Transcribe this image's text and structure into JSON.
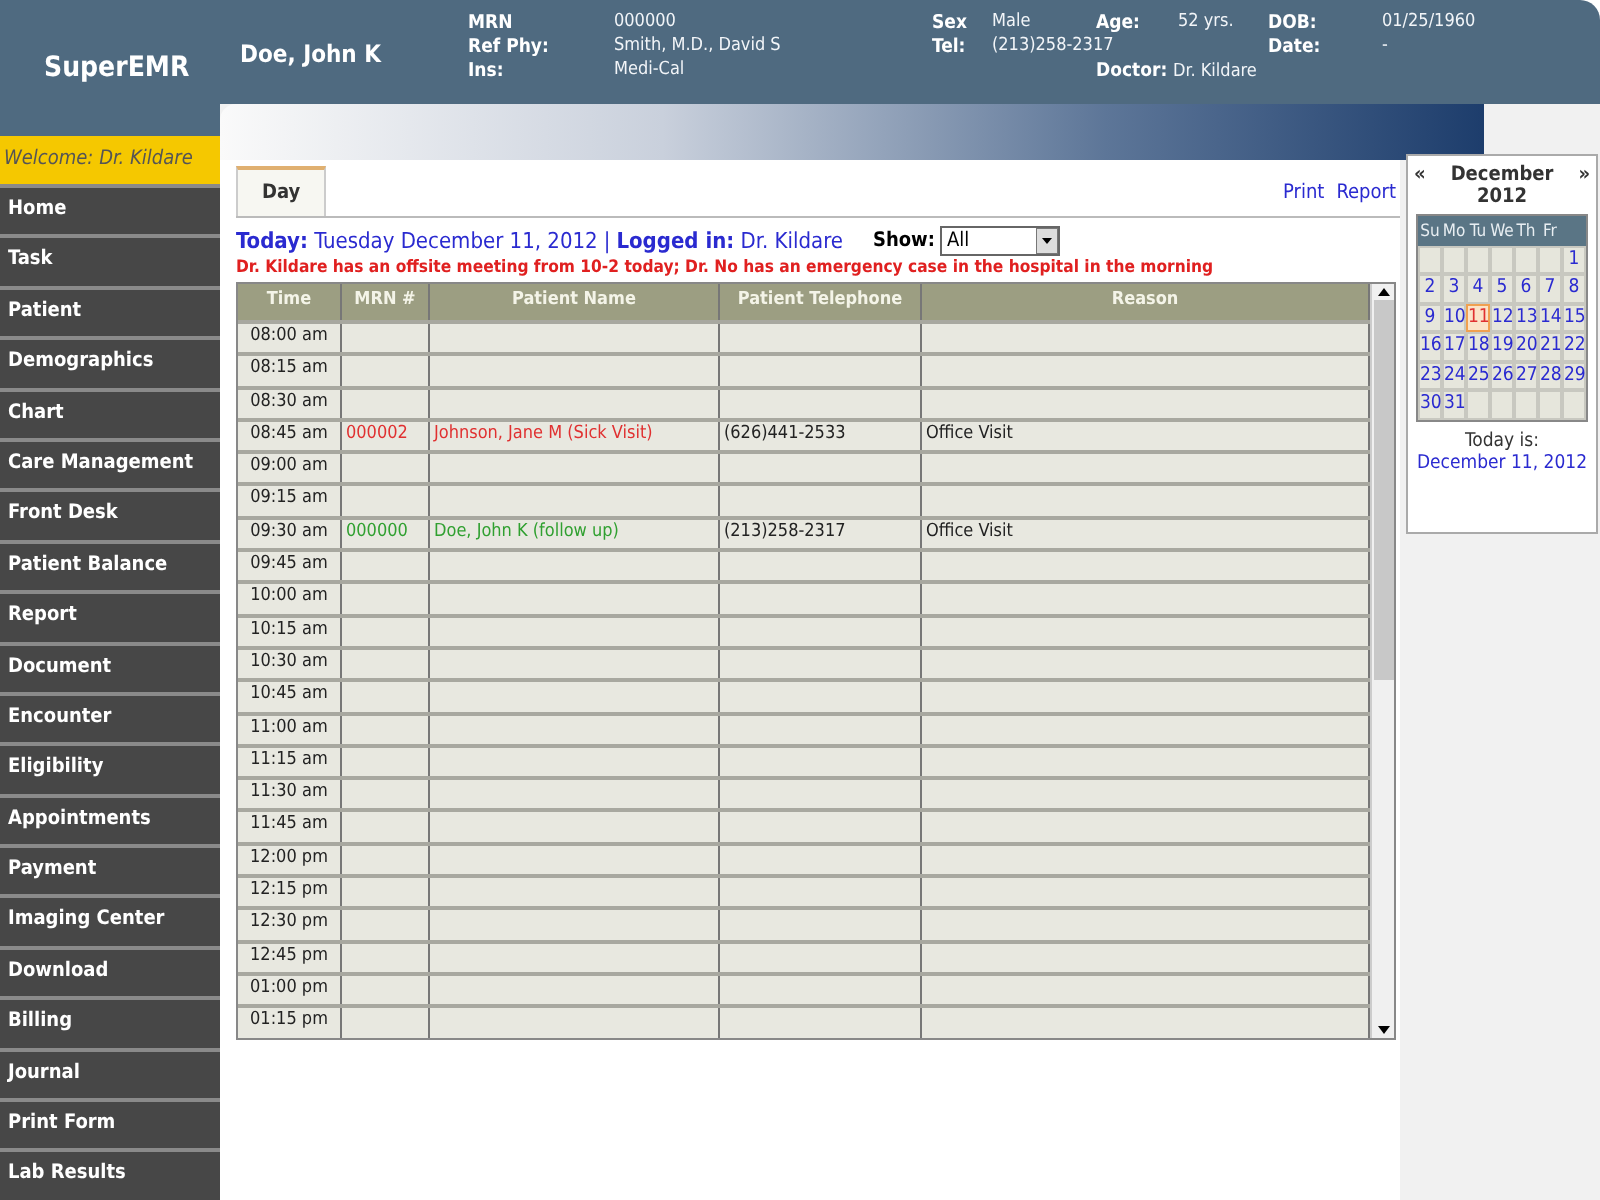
{
  "header": {
    "logo": "SuperEMR",
    "patient_name": "Doe, John K",
    "group_1": [
      {
        "label": "MRN",
        "value": "000000"
      },
      {
        "label": "Ref Phy:",
        "value": "Smith, M.D., David S"
      },
      {
        "label": "Ins:",
        "value": "Medi-Cal"
      }
    ],
    "group_2": [
      {
        "label": "Sex",
        "value": "Male"
      },
      {
        "label": "Tel:",
        "value": "(213)258-2317"
      }
    ],
    "group_3": [
      {
        "label": "Age:",
        "value": "52 yrs."
      }
    ],
    "doctor": {
      "label": "Doctor:",
      "value": "Dr. Kildare"
    },
    "group_4": [
      {
        "label": "DOB:",
        "value": "01/25/1960"
      },
      {
        "label": "Date:",
        "value": "-"
      }
    ]
  },
  "sidebar": {
    "welcome": "Welcome: Dr. Kildare",
    "items": [
      "Home",
      "Task",
      "Patient",
      "Demographics",
      "Chart",
      "Care Management",
      "Front Desk",
      "Patient Balance",
      "Report",
      "Document",
      "Encounter",
      "Eligibility",
      "Appointments",
      "Payment",
      "Imaging Center",
      "Download",
      "Billing",
      "Journal",
      "Print Form",
      "Lab Results"
    ]
  },
  "tabs": [
    {
      "label": "Day",
      "selected": true
    }
  ],
  "links": [
    "Print",
    "Report"
  ],
  "today_label": "Today:",
  "today_value": "Tuesday December 11, 2012",
  "separator": "|",
  "logged_label": "Logged in:",
  "logged_value": "Dr. Kildare",
  "show": {
    "label": "Show:",
    "value": "All"
  },
  "notice": "Dr. Kildare has an offsite meeting from 10-2 today; Dr. No has an emergency case in the hospital in the morning",
  "table": {
    "columns": [
      "Time",
      "MRN #",
      "Patient Name",
      "Patient Telephone",
      "Reason"
    ],
    "rows": [
      {
        "time": "08:00 am"
      },
      {
        "time": "08:15 am"
      },
      {
        "time": "08:30 am"
      },
      {
        "time": "08:45 am",
        "mrn": "000002",
        "patient": "Johnson, Jane M (Sick Visit)",
        "telephone": "(626)441-2533",
        "reason": "Office Visit",
        "color": "#e03030"
      },
      {
        "time": "09:00 am"
      },
      {
        "time": "09:15 am"
      },
      {
        "time": "09:30 am",
        "mrn": "000000",
        "patient": "Doe, John K (follow up)",
        "telephone": "(213)258-2317",
        "reason": "Office Visit",
        "color": "#30a030"
      },
      {
        "time": "09:45 am"
      },
      {
        "time": "10:00 am"
      },
      {
        "time": "10:15 am"
      },
      {
        "time": "10:30 am"
      },
      {
        "time": "10:45 am"
      },
      {
        "time": "11:00 am"
      },
      {
        "time": "11:15 am"
      },
      {
        "time": "11:30 am"
      },
      {
        "time": "11:45 am"
      },
      {
        "time": "12:00 pm"
      },
      {
        "time": "12:15 pm"
      },
      {
        "time": "12:30 pm"
      },
      {
        "time": "12:45 pm"
      },
      {
        "time": "01:00 pm"
      },
      {
        "time": "01:15 pm"
      }
    ]
  },
  "calendar": {
    "prev": "«",
    "next": "»",
    "month": "December",
    "year": "2012",
    "weekdays": [
      "Su",
      "Mo",
      "Tu",
      "We",
      "Th",
      "Fr"
    ],
    "weeks": [
      [
        {
          "day": "1",
          "selected": false
        }
      ],
      [
        {
          "day": "2",
          "selected": false
        },
        {
          "day": "3",
          "selected": false
        },
        {
          "day": "4",
          "selected": false
        },
        {
          "day": "5",
          "selected": false
        },
        {
          "day": "6",
          "selected": false
        },
        {
          "day": "7",
          "selected": false
        },
        {
          "day": "8",
          "selected": false
        }
      ],
      [
        {
          "day": "9",
          "selected": false
        },
        {
          "day": "10",
          "selected": false
        },
        {
          "day": "11",
          "selected": true
        },
        {
          "day": "12",
          "selected": false
        },
        {
          "day": "13",
          "selected": false
        },
        {
          "day": "14",
          "selected": false
        },
        {
          "day": "15",
          "selected": false
        }
      ],
      [
        {
          "day": "16",
          "selected": false
        },
        {
          "day": "17",
          "selected": false
        },
        {
          "day": "18",
          "selected": false
        },
        {
          "day": "19",
          "selected": false
        },
        {
          "day": "20",
          "selected": false
        },
        {
          "day": "21",
          "selected": false
        },
        {
          "day": "22",
          "selected": false
        }
      ],
      [
        {
          "day": "23",
          "selected": false
        },
        {
          "day": "24",
          "selected": false
        },
        {
          "day": "25",
          "selected": false
        },
        {
          "day": "26",
          "selected": false
        },
        {
          "day": "27",
          "selected": false
        },
        {
          "day": "28",
          "selected": false
        },
        {
          "day": "29",
          "selected": false
        }
      ],
      [
        {
          "day": "30",
          "selected": false
        },
        {
          "day": "31",
          "selected": false
        }
      ]
    ],
    "today_label": "Today is:",
    "today_value": "December 11, 2012"
  }
}
